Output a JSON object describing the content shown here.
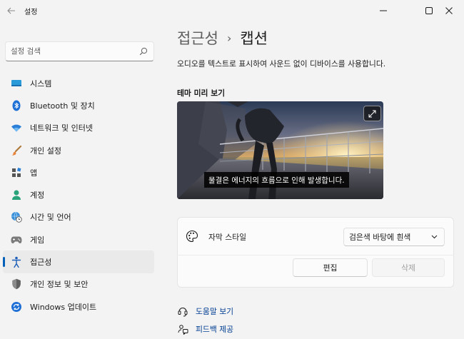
{
  "window": {
    "title": "설정"
  },
  "search": {
    "placeholder": "설정 검색"
  },
  "sidebar": {
    "items": [
      {
        "label": "시스템",
        "icon": "monitor-icon"
      },
      {
        "label": "Bluetooth 및 장치",
        "icon": "bluetooth-icon"
      },
      {
        "label": "네트워크 및 인터넷",
        "icon": "wifi-icon"
      },
      {
        "label": "개인 설정",
        "icon": "paintbrush-icon"
      },
      {
        "label": "앱",
        "icon": "apps-icon"
      },
      {
        "label": "계정",
        "icon": "person-icon"
      },
      {
        "label": "시간 및 언어",
        "icon": "globe-clock-icon"
      },
      {
        "label": "게임",
        "icon": "gamepad-icon"
      },
      {
        "label": "접근성",
        "icon": "accessibility-icon",
        "selected": true
      },
      {
        "label": "개인 정보 및 보안",
        "icon": "shield-icon"
      },
      {
        "label": "Windows 업데이트",
        "icon": "update-icon"
      }
    ]
  },
  "main": {
    "breadcrumb_parent": "접근성",
    "breadcrumb_separator": "›",
    "breadcrumb_current": "캡션",
    "description": "오디오를 텍스트로 표시하여 사운드 없이 디바이스를 사용합니다.",
    "preview_title": "테마 미리 보기",
    "preview_caption": "물결은 에너지의 흐름으로 인해 발생합니다.",
    "caption_style_label": "자막 스타일",
    "caption_style_value": "검은색 바탕에 흰색",
    "edit_label": "편집",
    "delete_label": "삭제",
    "links": [
      {
        "label": "도움말 보기",
        "icon": "help-icon"
      },
      {
        "label": "피드백 제공",
        "icon": "feedback-icon"
      }
    ]
  },
  "colors": {
    "accent": "#005fb8",
    "link": "#003e92",
    "background": "#f3f3f3"
  }
}
